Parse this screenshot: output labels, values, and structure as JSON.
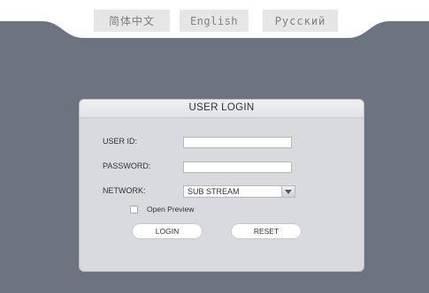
{
  "languages": [
    {
      "label": "简体中文"
    },
    {
      "label": "English"
    },
    {
      "label": "Русский"
    }
  ],
  "login": {
    "title": "USER LOGIN",
    "user_id_label": "USER ID:",
    "user_id_value": "",
    "password_label": "PASSWORD:",
    "password_value": "",
    "network_label": "NETWORK:",
    "network_value": "SUB STREAM",
    "open_preview_label": "Open Preview",
    "open_preview_checked": false,
    "login_button": "LOGIN",
    "reset_button": "RESET"
  },
  "colors": {
    "background": "#6e747f",
    "panel": "#d9dadd",
    "header_white": "#ffffff"
  },
  "icons": {
    "dropdown": "dropdown-arrow-icon"
  }
}
